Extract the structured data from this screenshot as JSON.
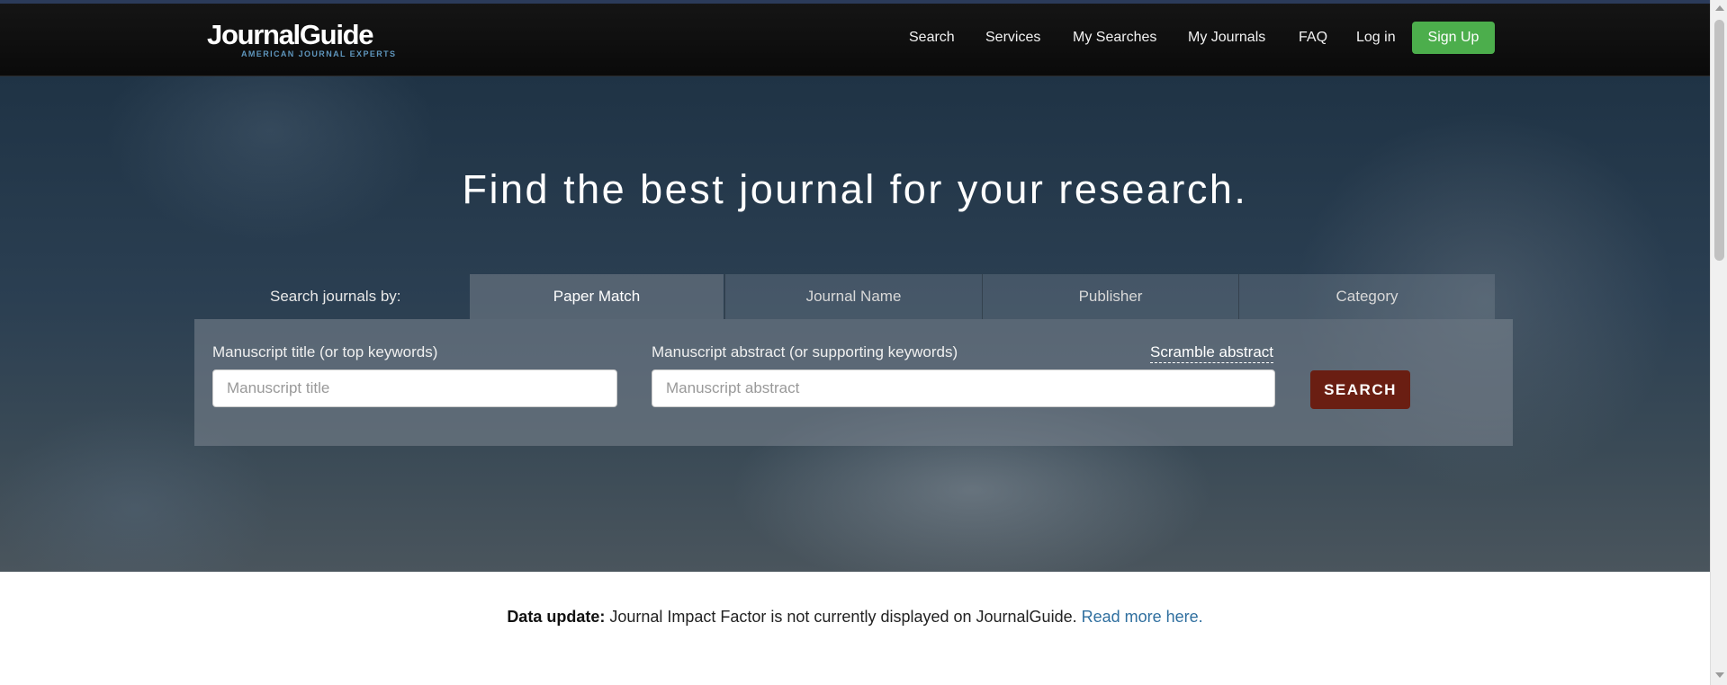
{
  "header": {
    "logo_main": "JournalGuide",
    "logo_sub": "AMERICAN JOURNAL EXPERTS",
    "nav": [
      "Search",
      "Services",
      "My Searches",
      "My Journals",
      "FAQ",
      "Log in"
    ],
    "signup_label": "Sign Up"
  },
  "hero": {
    "title": "Find the best journal for your research.",
    "tabs_label": "Search journals by:",
    "tabs": [
      "Paper Match",
      "Journal Name",
      "Publisher",
      "Category"
    ],
    "active_tab": "Paper Match"
  },
  "form": {
    "title_label": "Manuscript title (or top keywords)",
    "title_placeholder": "Manuscript title",
    "title_value": "",
    "abstract_label": "Manuscript abstract (or supporting keywords)",
    "abstract_placeholder": "Manuscript abstract",
    "abstract_value": "",
    "scramble_label": "Scramble abstract",
    "search_label": "SEARCH"
  },
  "notice": {
    "bold": "Data update:",
    "text": " Journal Impact Factor is not currently displayed on JournalGuide. ",
    "link": "Read more here."
  },
  "colors": {
    "navbar": "#0f0f0f",
    "signup_button": "#4cae4c",
    "search_button": "#6a1e12",
    "link": "#2f6f9f",
    "logo_sub": "#5f96bd"
  }
}
